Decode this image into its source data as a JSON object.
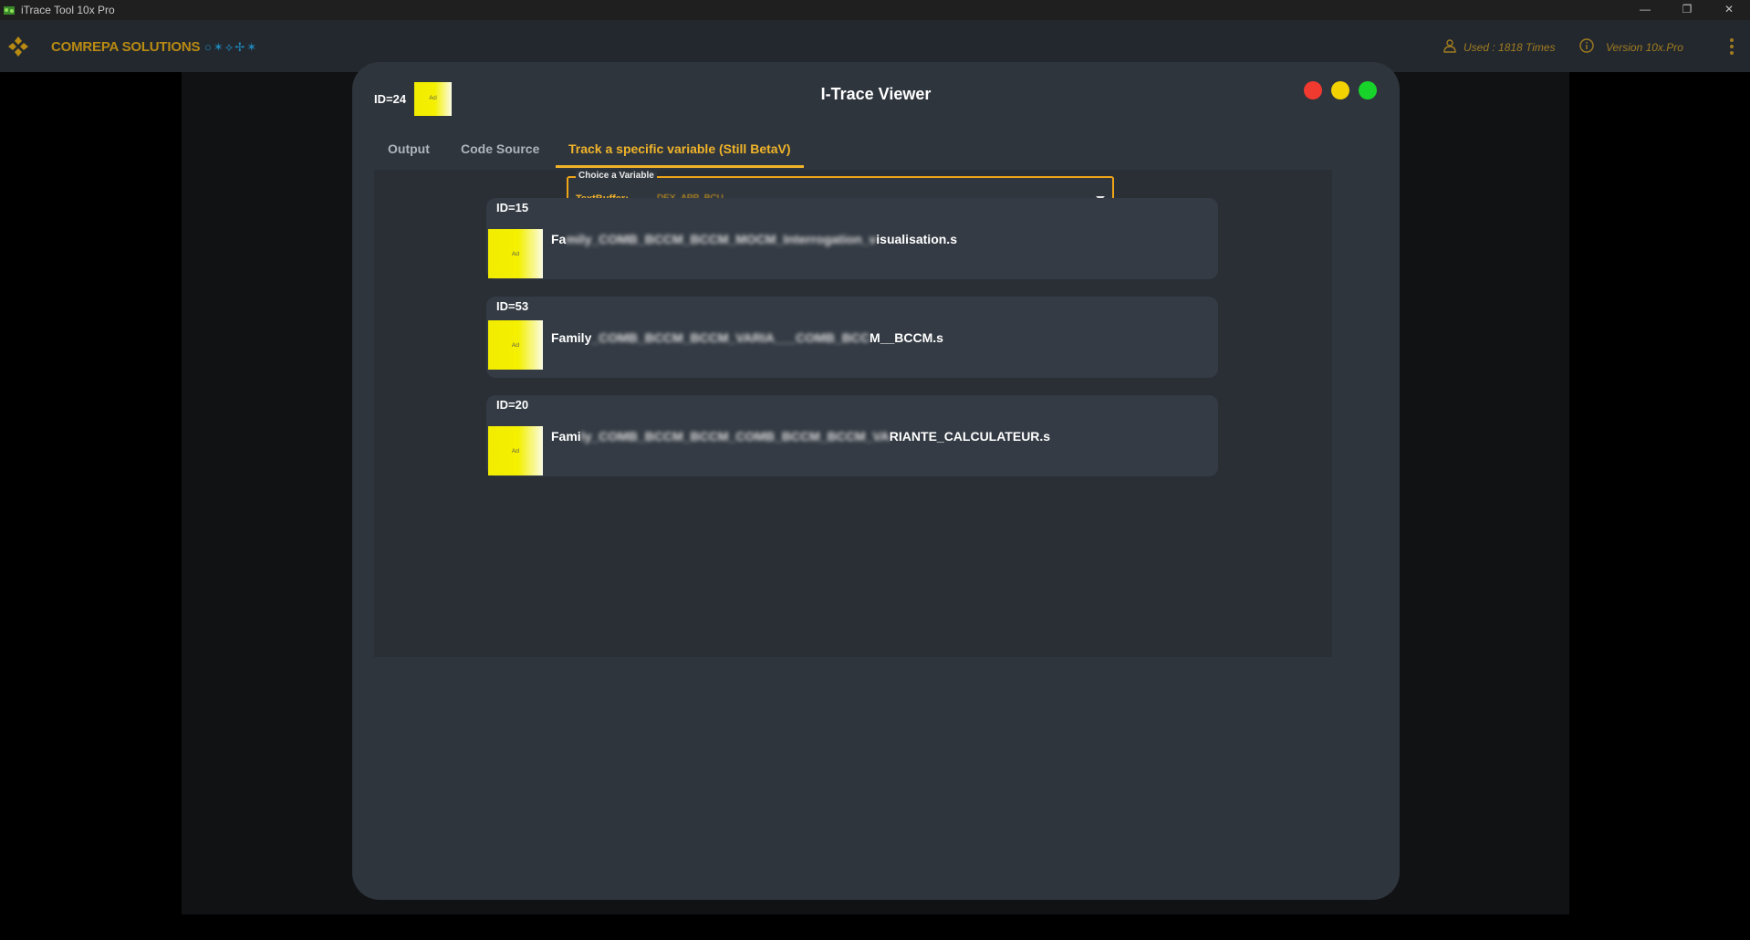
{
  "window": {
    "title": "iTrace Tool 10x Pro",
    "controls": {
      "minimize": "—",
      "maximize": "❐",
      "close": "✕"
    }
  },
  "header": {
    "brand": "COMREPA SOLUTIONS",
    "brand_decoration": "○✶⟡✢✶",
    "usage": "Used : 1818 Times",
    "version": "Version 10x.Pro",
    "accent_color": "#b88a12"
  },
  "modal": {
    "id_label": "ID=24",
    "thumb_text": "Acl",
    "title": "I-Trace Viewer",
    "tabs": [
      {
        "label": "Output",
        "active": false
      },
      {
        "label": "Code Source",
        "active": false
      },
      {
        "label": "Track a specific variable (Still BetaV)",
        "active": true
      }
    ],
    "select": {
      "legend": "Choice a Variable",
      "label": "TextBuffer:",
      "value": "DEX_APP_BCU"
    },
    "results": [
      {
        "id": "ID=15",
        "thumb_text": "Acl",
        "name_prefix": "Fa",
        "name_blurred": "mily_COMB_BCCM_BCCM_MOCM_Interrogation_v",
        "name_suffix": "isualisation.s"
      },
      {
        "id": "ID=53",
        "thumb_text": "Acl",
        "name_prefix": "Family",
        "name_blurred": "_COMB_BCCM_BCCM_VARIA___COMB_BCC",
        "name_suffix": "M__BCCM.s"
      },
      {
        "id": "ID=20",
        "thumb_text": "Acl",
        "name_prefix": "Fami",
        "name_blurred": "ly_COMB_BCCM_BCCM_COMB_BCCM_BCCM_VA",
        "name_suffix": "RIANTE_CALCULATEUR.s"
      }
    ],
    "colors": {
      "accent": "#f0b429",
      "close": "#f0392f",
      "minimize": "#f2d200",
      "maximize": "#18d42a"
    }
  }
}
